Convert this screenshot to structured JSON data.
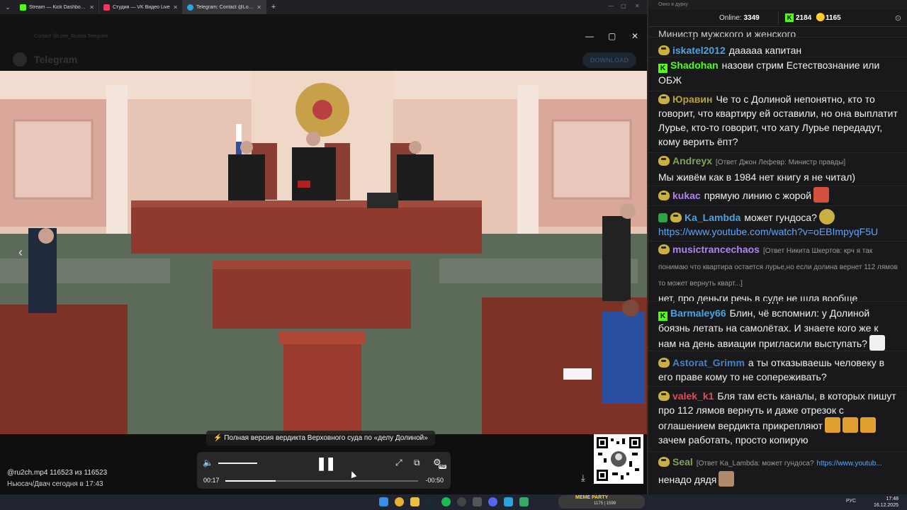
{
  "browser": {
    "tabs": [
      {
        "title": "Stream — Kick Dashboard",
        "color": "#53fc18"
      },
      {
        "title": "Студия — VK Видео Live",
        "color": "#e83a5e"
      },
      {
        "title": "Telegram: Contact @Love_Russ...",
        "color": "#2aa3df"
      }
    ],
    "faint_title": "Contact @Love_Russia Telegram",
    "telegram_name": "Telegram",
    "download_label": "DOWNLOAD"
  },
  "video": {
    "caption": "⚡ Полная версия вердикта Верховного суда по «делу Долиной»",
    "time_current": "00:17",
    "time_remaining": "-00:50",
    "progress": 0.26,
    "file_name": "@ru2ch.mp4 116523 из 116523",
    "file_meta": "Ньюсач/Двач  сегодня в 17:43",
    "hd": "HD"
  },
  "chat": {
    "window_title": "Окно в дурку",
    "online_label": "Online:",
    "online_count": "3349",
    "kick_count": "2184",
    "vk_count": "1165",
    "partial_top": "Министр мужского и женского",
    "messages": [
      {
        "platform": "vk",
        "user": "iskatel2012",
        "color": "#4aa3e0",
        "text": "дааааа капитан"
      },
      {
        "platform": "kick",
        "user": "Shadohan",
        "color": "#53fc18",
        "text": "назови стрим Естествознание или ОБЖ"
      },
      {
        "platform": "vk",
        "user": "Юравин",
        "color": "#b3a33a",
        "text": "Че то с Долиной непонятно, кто то говорит, что квартиру ей оставили, но она выплатит Лурье, кто-то говорит, что хату Лурье передадут, кому верить ёпт?"
      },
      {
        "platform": "vk",
        "user": "Andreyx",
        "color": "#7fa35a",
        "reply": "[Ответ Джон Лефевр: Министр правды]",
        "text": "Мы живём как в 1984 нет книгу я не читал)"
      },
      {
        "platform": "vk",
        "user": "kukac",
        "color": "#b084f0",
        "text": "прямую линию с жорой"
      },
      {
        "platform": "vk",
        "user": "Ka_Lambda",
        "color": "#4aa3e0",
        "text": "может гундоса?",
        "link": "https://www.youtube.com/watch?v=oEBImpyqF5U"
      },
      {
        "platform": "vk",
        "user": "musictrancechaos",
        "color": "#b084f0",
        "reply": "[Ответ Никита Шкертов: крч я так понимаю что квартира остается лурье,но если долина вернет 112 лямов то может вернуть кварт...]",
        "text": "нет, про деньги речь в суде не шла вообще"
      },
      {
        "platform": "kick",
        "user": "Barmaley66",
        "color": "#4aa3e0",
        "text": "Блин, чё вспомнил: у Долиной боязнь летать на самолётах. И знаете кого же к нам на день авиации пригласили выступать?"
      },
      {
        "platform": "vk",
        "user": "Astorat_Grimm",
        "color": "#4a7fc0",
        "text": "а ты отказываешь человеку в его праве кому то не сопереживать?"
      },
      {
        "platform": "vk",
        "user": "valek_k1",
        "color": "#e04a5a",
        "text": "Бля там есть каналы, в которых пишут про 112 лямов вернуть и даже отрезок с оглашением вердикта прикрепляют",
        "text2": "зачем работать, просто копирую"
      },
      {
        "platform": "vk",
        "user": "Seal",
        "color": "#7fa35a",
        "reply": "[Ответ Ka_Lambda: может гундоса?",
        "link": "https://www.youtub...",
        "text": "ненадо дядя"
      }
    ]
  },
  "taskbar": {
    "widget_title": "MEME PARTY",
    "widget_nums": "1175 | 1599",
    "lang": "РУС",
    "time": "17:48",
    "date": "16.12.2025"
  }
}
